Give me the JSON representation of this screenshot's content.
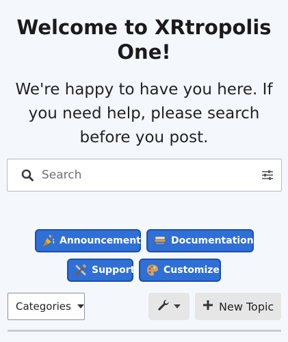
{
  "welcome": {
    "title": "Welcome to XRtropolis One!",
    "subtitle": "We're happy to have you here. If you need help, please search before you post."
  },
  "search": {
    "placeholder": "Search",
    "icon": "search-icon",
    "filter_icon": "sliders-icon"
  },
  "chips": [
    {
      "label": "Announcement",
      "icon": "party-popper-icon"
    },
    {
      "label": "Documentation",
      "icon": "books-icon"
    },
    {
      "label": "Support",
      "icon": "tools-icon"
    },
    {
      "label": "Customize",
      "icon": "palette-icon"
    }
  ],
  "toolbar": {
    "categories_label": "Categories",
    "wrench_icon": "wrench-icon",
    "new_topic_label": "New Topic"
  },
  "colors": {
    "background": "#f4f8fd",
    "chip_fill": "#2f6fd6",
    "chip_border": "#1b4fa8",
    "button_gray": "#e6e6e6"
  }
}
